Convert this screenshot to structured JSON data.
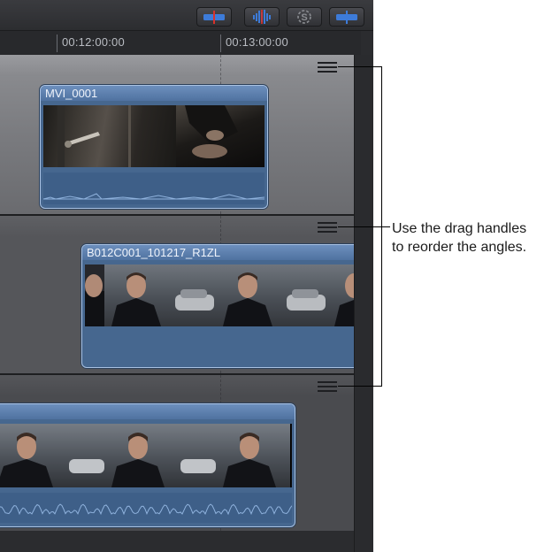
{
  "toolbar": {
    "buttons": [
      {
        "name": "video-only-button",
        "icon": "video-only-icon",
        "accent": "#3d7bd9",
        "marker": "#d8322c"
      },
      {
        "name": "audio-only-button",
        "icon": "audio-waveform-icon",
        "accent": "#3d7bd9"
      },
      {
        "name": "solo-button",
        "icon": "solo-icon",
        "accent": "#8b8d92"
      },
      {
        "name": "video-audio-button",
        "icon": "video-audio-icon",
        "accent": "#3d7bd9"
      }
    ]
  },
  "ruler": {
    "timecodes": [
      "00:12:00:00",
      "00:13:00:00"
    ]
  },
  "angles": [
    {
      "clip_name": "MVI_0001",
      "selected": true
    },
    {
      "clip_name": "B012C001_101217_R1ZL",
      "selected": false
    },
    {
      "clip_name": "",
      "selected": false
    }
  ],
  "callout": {
    "line1": "Use the drag handles",
    "line2": "to reorder the angles."
  },
  "colors": {
    "clip_fill": "#46678f",
    "clip_header": "#5f82b1",
    "waveform": "#8fb2dd",
    "panel_bg": "#2b2c2f"
  }
}
